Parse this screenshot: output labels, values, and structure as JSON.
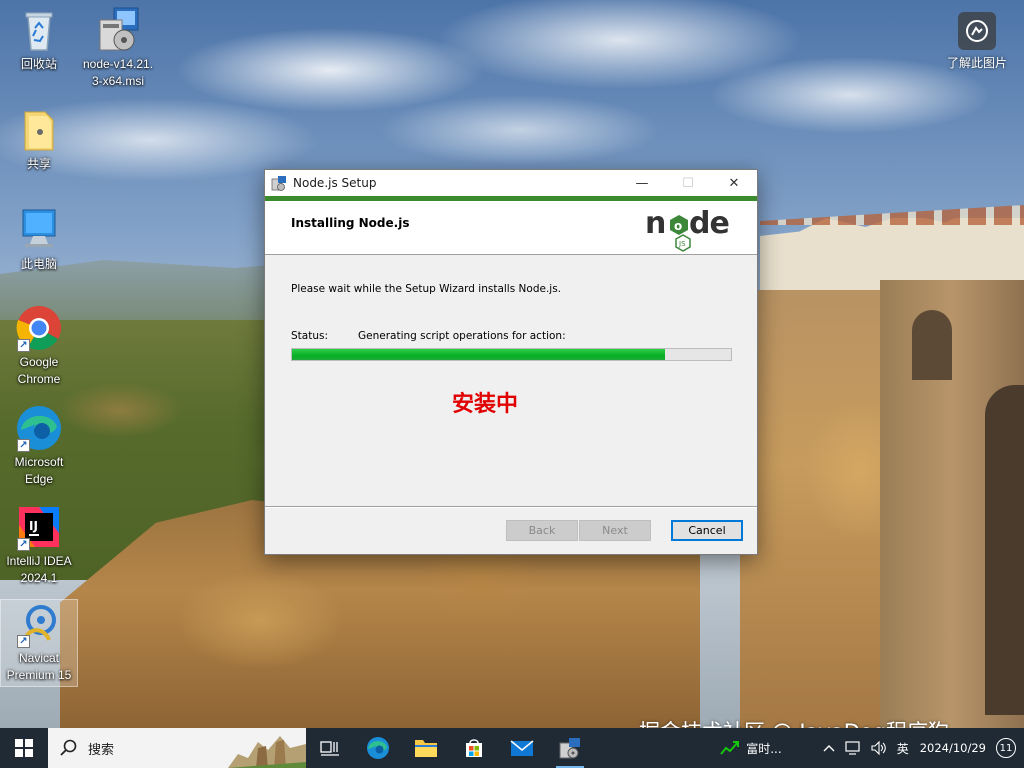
{
  "desktop": {
    "icons": [
      {
        "label": "回收站"
      },
      {
        "label": "node-v14.21.3-x64.msi"
      },
      {
        "label": "共享"
      },
      {
        "label": "此电脑"
      },
      {
        "label": "Google Chrome"
      },
      {
        "label": "Microsoft Edge"
      },
      {
        "label": "IntelliJ IDEA 2024.1"
      },
      {
        "label": "Navicat Premium 15"
      }
    ],
    "right_icon_label": "了解此图片"
  },
  "setup_window": {
    "title": "Node.js Setup",
    "controls": {
      "minimize": "—",
      "maximize": "☐",
      "close": "✕"
    },
    "header_title": "Installing Node.js",
    "wait_message": "Please wait while the Setup Wizard installs Node.js.",
    "status_label": "Status:",
    "status_value": "Generating script operations for action:",
    "progress_percent": 85,
    "overlay_caption": "安装中",
    "buttons": {
      "back": "Back",
      "next": "Next",
      "cancel": "Cancel"
    },
    "accent_color": "#3c8a2e",
    "progress_color": "#06b025"
  },
  "watermark": "掘金技术社区 @ JavaDog程序狗",
  "taskbar": {
    "search_placeholder": "搜索",
    "weather_text": "富时...",
    "ime": "英",
    "time": "",
    "date": "2024/10/29",
    "notification_count": "11"
  }
}
